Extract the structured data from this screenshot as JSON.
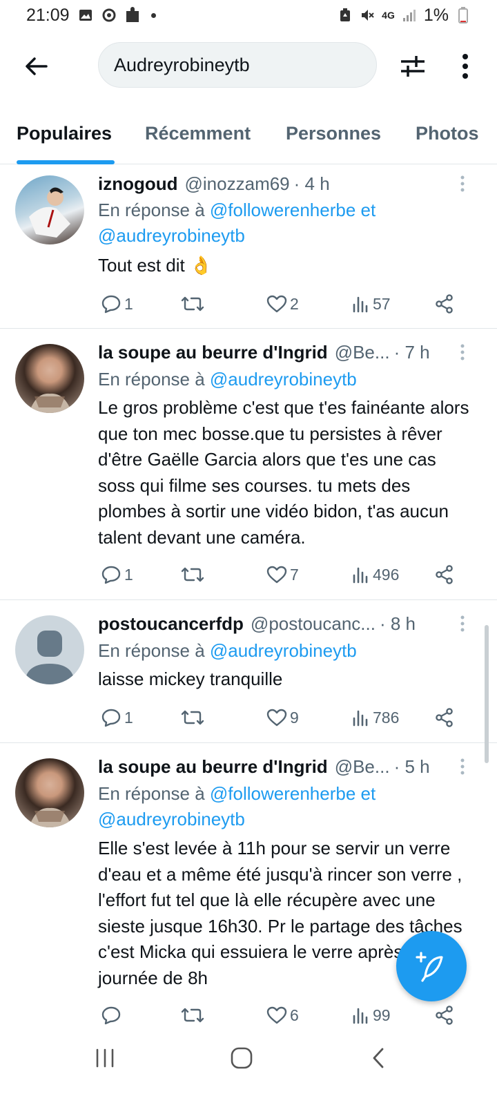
{
  "status_bar": {
    "time": "21:09",
    "network": "4G",
    "battery": "1%"
  },
  "search": {
    "query": "Audreyrobineytb"
  },
  "tabs": [
    {
      "label": "Populaires",
      "active": true
    },
    {
      "label": "Récemment",
      "active": false
    },
    {
      "label": "Personnes",
      "active": false
    },
    {
      "label": "Photos",
      "active": false
    }
  ],
  "reply_prefix": "En réponse à",
  "reply_conjunction": "et",
  "tweets": [
    {
      "name": "iznogoud",
      "handle": "@inozzam69",
      "time": "· 4 h",
      "reply_to": [
        "@followerenherbe",
        "@audreyrobineytb"
      ],
      "text": "Tout est dit 👌",
      "replies": "1",
      "retweets": "",
      "likes": "2",
      "views": "57"
    },
    {
      "name": "la soupe au beurre d'Ingrid",
      "handle": "@Be...",
      "time": "· 7 h",
      "reply_to": [
        "@audreyrobineytb"
      ],
      "text": "Le gros problème c'est que t'es fainéante alors que ton mec bosse.que tu persistes à rêver d'être Gaëlle Garcia alors que t'es une cas soss qui filme ses courses. tu mets des plombes à sortir une vidéo bidon, t'as aucun talent devant une caméra.",
      "replies": "1",
      "retweets": "",
      "likes": "7",
      "views": "496"
    },
    {
      "name": "postoucancerfdp",
      "handle": "@postoucanc...",
      "time": "· 8 h",
      "reply_to": [
        "@audreyrobineytb"
      ],
      "text": "laisse mickey tranquille",
      "replies": "1",
      "retweets": "",
      "likes": "9",
      "views": "786"
    },
    {
      "name": "la soupe au beurre d'Ingrid",
      "handle": "@Be...",
      "time": "· 5 h",
      "reply_to": [
        "@followerenherbe",
        "@audreyrobineytb"
      ],
      "text": "Elle s'est levée à 11h pour se servir un verre d'eau et a même été jusqu'à rincer son verre , l'effort fut tel que là elle récupère avec une sieste jusque 16h30. Pr le partage des tâches c'est Micka qui essuiera le verre après sa journée de 8h",
      "replies": "",
      "retweets": "",
      "likes": "6",
      "views": "99"
    }
  ],
  "colors": {
    "accent": "#1d9bf0",
    "text_primary": "#0f1419",
    "text_secondary": "#536471",
    "divider": "#e1e6e9"
  },
  "icons": {
    "back": "arrow-left-icon",
    "filter": "sliders-icon",
    "more": "more-vertical-icon",
    "reply": "comment-icon",
    "retweet": "retweet-icon",
    "like": "heart-icon",
    "views": "bar-chart-icon",
    "share": "share-icon",
    "compose": "feather-plus-icon"
  }
}
